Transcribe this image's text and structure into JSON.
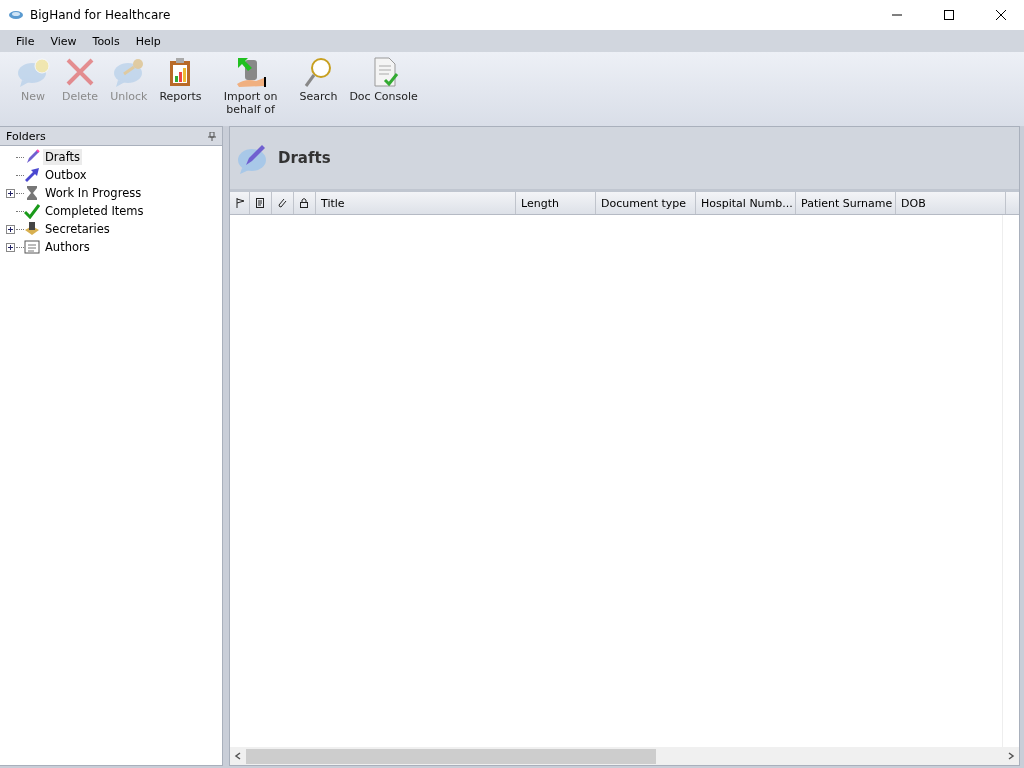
{
  "window": {
    "title": "BigHand for Healthcare"
  },
  "menu": [
    "File",
    "View",
    "Tools",
    "Help"
  ],
  "toolbar": [
    {
      "label": "New",
      "kind": "new",
      "disabled": true
    },
    {
      "label": "Delete",
      "kind": "delete",
      "disabled": true
    },
    {
      "label": "Unlock",
      "kind": "unlock",
      "disabled": true
    },
    {
      "label": "Reports",
      "kind": "reports",
      "disabled": false
    },
    {
      "label": "Import on behalf of",
      "kind": "import",
      "disabled": false
    },
    {
      "label": "Search",
      "kind": "search",
      "disabled": false
    },
    {
      "label": "Doc Console",
      "kind": "console",
      "disabled": false
    }
  ],
  "folders": {
    "title": "Folders",
    "items": [
      {
        "label": "Drafts",
        "kind": "drafts",
        "selected": true,
        "expandable": false
      },
      {
        "label": "Outbox",
        "kind": "outbox",
        "selected": false,
        "expandable": false
      },
      {
        "label": "Work In Progress",
        "kind": "progress",
        "selected": false,
        "expandable": true
      },
      {
        "label": "Completed Items",
        "kind": "completed",
        "selected": false,
        "expandable": false
      },
      {
        "label": "Secretaries",
        "kind": "secretaries",
        "selected": false,
        "expandable": true
      },
      {
        "label": "Authors",
        "kind": "authors",
        "selected": false,
        "expandable": true
      }
    ]
  },
  "content": {
    "title": "Drafts",
    "columns": [
      {
        "kind": "flag"
      },
      {
        "kind": "clip"
      },
      {
        "kind": "attach"
      },
      {
        "kind": "lock"
      },
      {
        "kind": "text",
        "label": "Title"
      },
      {
        "kind": "text",
        "label": "Length"
      },
      {
        "kind": "text",
        "label": "Document type"
      },
      {
        "kind": "text",
        "label": "Hospital Numb..."
      },
      {
        "kind": "text",
        "label": "Patient Surname"
      },
      {
        "kind": "text",
        "label": "DOB"
      }
    ]
  }
}
